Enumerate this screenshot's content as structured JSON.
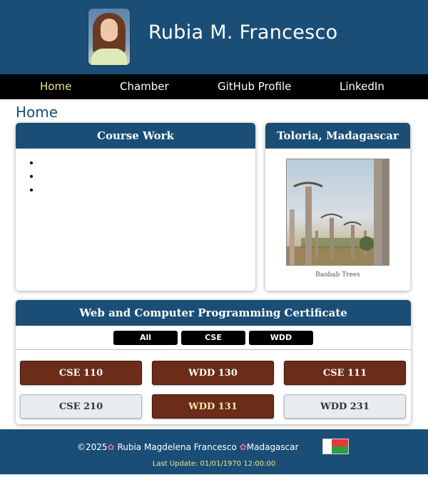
{
  "header": {
    "name": "Rubia M. Francesco"
  },
  "nav": {
    "items": [
      "Home",
      "Chamber",
      "GitHub Profile",
      "LinkedIn"
    ]
  },
  "main": {
    "heading": "Home",
    "coursework": {
      "title": "Course Work",
      "items": [
        "",
        "",
        ""
      ]
    },
    "location": {
      "title": "Toloria, Madagascar",
      "caption": "Baobab Trees"
    },
    "certificate": {
      "title": "Web and Computer Programming Certificate",
      "filters": [
        "All",
        "CSE",
        "WDD"
      ],
      "courses": [
        {
          "label": "CSE 110",
          "completed": true
        },
        {
          "label": "WDD 130",
          "completed": true
        },
        {
          "label": "CSE 111",
          "completed": true
        },
        {
          "label": "CSE 210",
          "completed": false
        },
        {
          "label": "WDD 131",
          "completed": true
        },
        {
          "label": "WDD 231",
          "completed": false
        }
      ]
    }
  },
  "footer": {
    "copyright": "©2025",
    "author": "Rubia Magdelena Francesco",
    "country": "Madagascar",
    "last_update": "Last Update: 01/01/1970 12:00:00"
  },
  "colors": {
    "primary": "#1a4e76",
    "nav_bg": "#000000",
    "active_nav": "#f2e58b",
    "completed_course": "#6b2c1a",
    "pending_course": "#e8ecee"
  }
}
